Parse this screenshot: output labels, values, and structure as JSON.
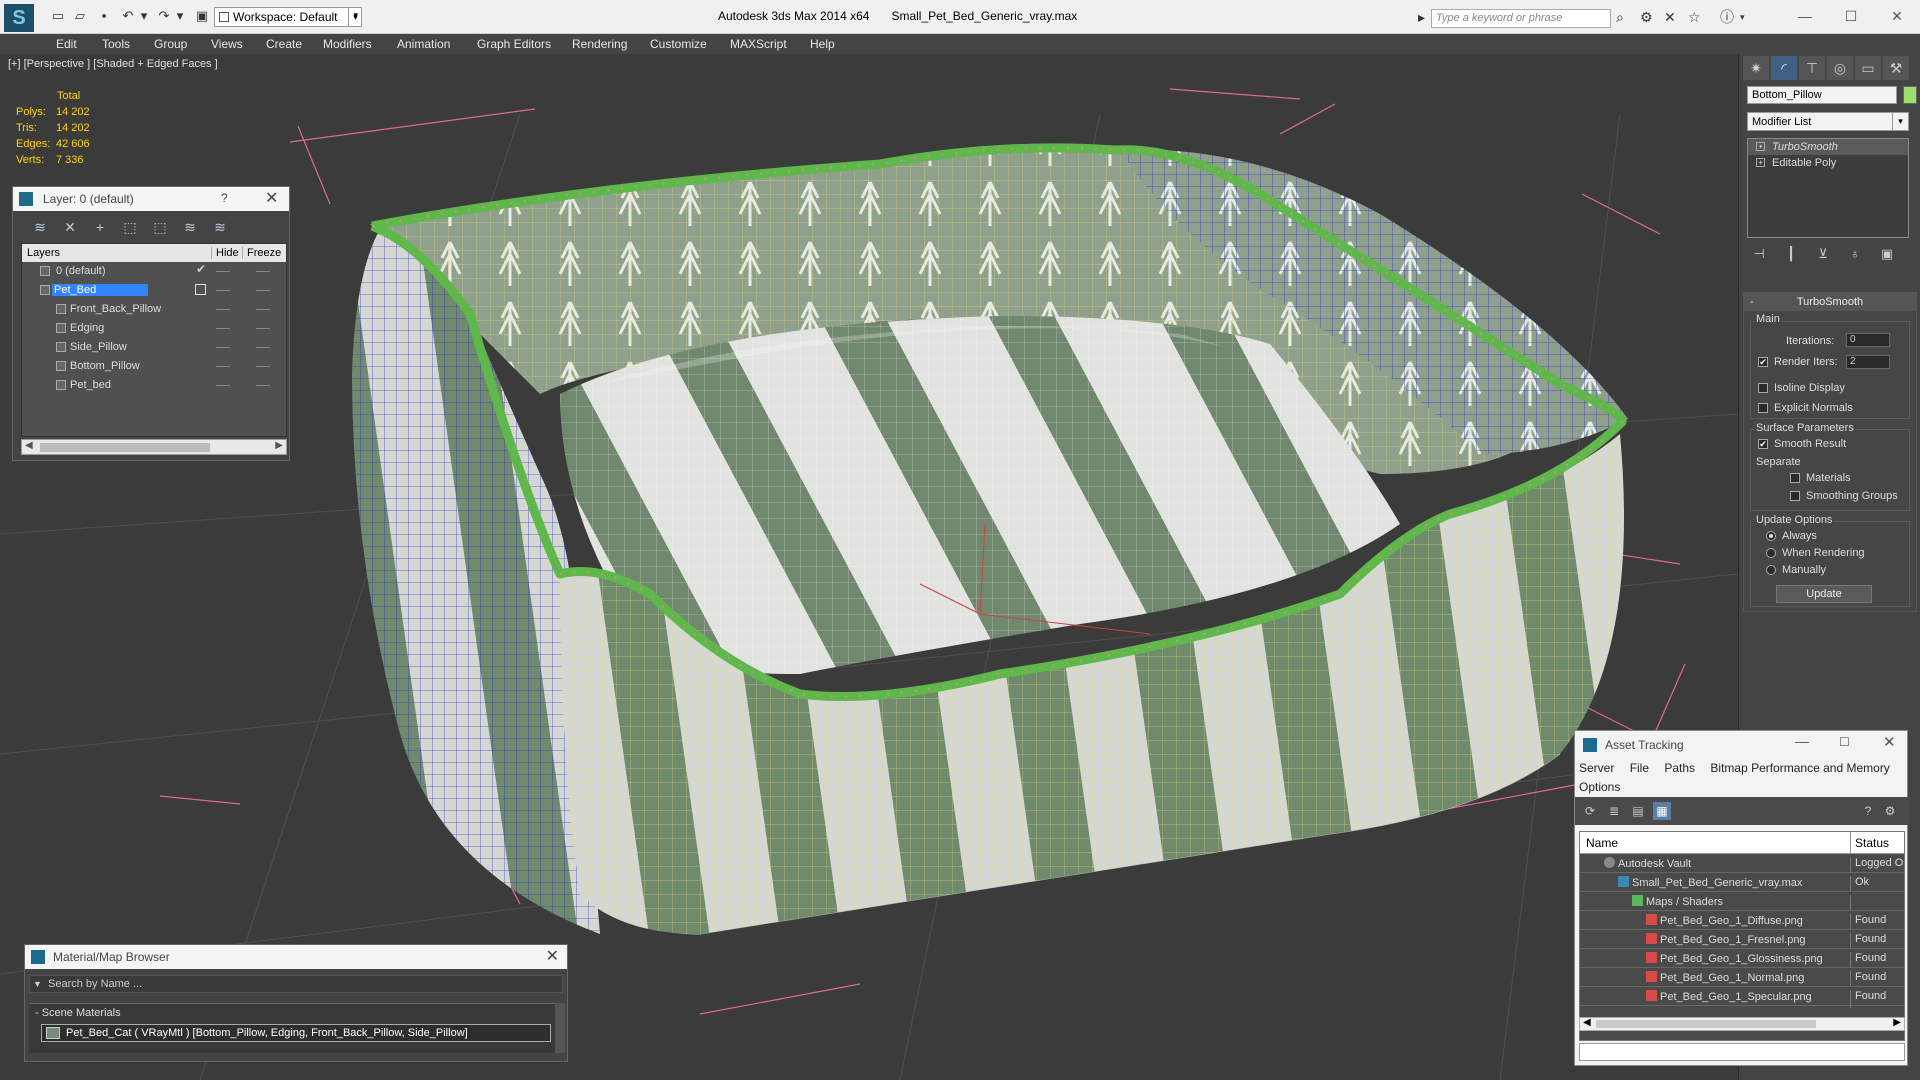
{
  "title_bar": {
    "app": "Autodesk 3ds Max  2014 x64",
    "file": "Small_Pet_Bed_Generic_vray.max",
    "workspace": "Workspace: Default",
    "search_placeholder": "Type a keyword or phrase"
  },
  "menu": [
    "Edit",
    "Tools",
    "Group",
    "Views",
    "Create",
    "Modifiers",
    "Animation",
    "Graph Editors",
    "Rendering",
    "Customize",
    "MAXScript",
    "Help"
  ],
  "viewport": {
    "label": "[+] [Perspective ] [Shaded + Edged Faces ]",
    "stats": {
      "header": "Total",
      "polys_label": "Polys:",
      "polys": "14 202",
      "tris_label": "Tris:",
      "tris": "14 202",
      "edges_label": "Edges:",
      "edges": "42 606",
      "verts_label": "Verts:",
      "verts": "7 336"
    }
  },
  "layer_window": {
    "title": "Layer: 0 (default)",
    "help": "?",
    "columns": {
      "layers": "Layers",
      "hide": "Hide",
      "freeze": "Freeze"
    },
    "rows": [
      "0 (default)",
      "Pet_Bed",
      "Front_Back_Pillow",
      "Edging",
      "Side_Pillow",
      "Bottom_Pillow",
      "Pet_bed"
    ]
  },
  "material_browser": {
    "title": "Material/Map Browser",
    "search": "Search by Name ...",
    "group": "- Scene Materials",
    "item": "Pet_Bed_Cat  ( VRayMtl ) [Bottom_Pillow, Edging, Front_Back_Pillow, Side_Pillow]"
  },
  "command_panel": {
    "object_name": "Bottom_Pillow",
    "object_color": "#9ae06a",
    "modifier_list": "Modifier List",
    "stack": [
      "TurboSmooth",
      "Editable Poly"
    ],
    "turbosmooth": {
      "rollout": "TurboSmooth",
      "main": "Main",
      "iterations_label": "Iterations:",
      "iterations": "0",
      "render_iters_label": "Render Iters:",
      "render_iters": "2",
      "isoline": "Isoline Display",
      "explicit": "Explicit Normals",
      "surface_params": "Surface Parameters",
      "smooth_result": "Smooth Result",
      "separate": "Separate",
      "materials": "Materials",
      "smoothing_groups": "Smoothing Groups",
      "update_options": "Update Options",
      "always": "Always",
      "when_rendering": "When Rendering",
      "manually": "Manually",
      "update_button": "Update"
    }
  },
  "asset_tracking": {
    "title": "Asset Tracking",
    "menu": [
      "Server",
      "File",
      "Paths",
      "Bitmap Performance and Memory"
    ],
    "menu2": "Options",
    "columns": {
      "name": "Name",
      "status": "Status"
    },
    "rows": [
      {
        "name": "Autodesk Vault",
        "status": "Logged Ou"
      },
      {
        "name": "Small_Pet_Bed_Generic_vray.max",
        "status": "Ok"
      },
      {
        "name": "Maps / Shaders",
        "status": ""
      },
      {
        "name": "Pet_Bed_Geo_1_Diffuse.png",
        "status": "Found"
      },
      {
        "name": "Pet_Bed_Geo_1_Fresnel.png",
        "status": "Found"
      },
      {
        "name": "Pet_Bed_Geo_1_Glossiness.png",
        "status": "Found"
      },
      {
        "name": "Pet_Bed_Geo_1_Normal.png",
        "status": "Found"
      },
      {
        "name": "Pet_Bed_Geo_1_Specular.png",
        "status": "Found"
      }
    ]
  },
  "colors": {
    "stats": "#ffd400",
    "selection": "#3385ff",
    "edging": "#5fb84a",
    "fabric_light": "#cfd3cd",
    "fabric_stripe": "#6f8a6c"
  }
}
